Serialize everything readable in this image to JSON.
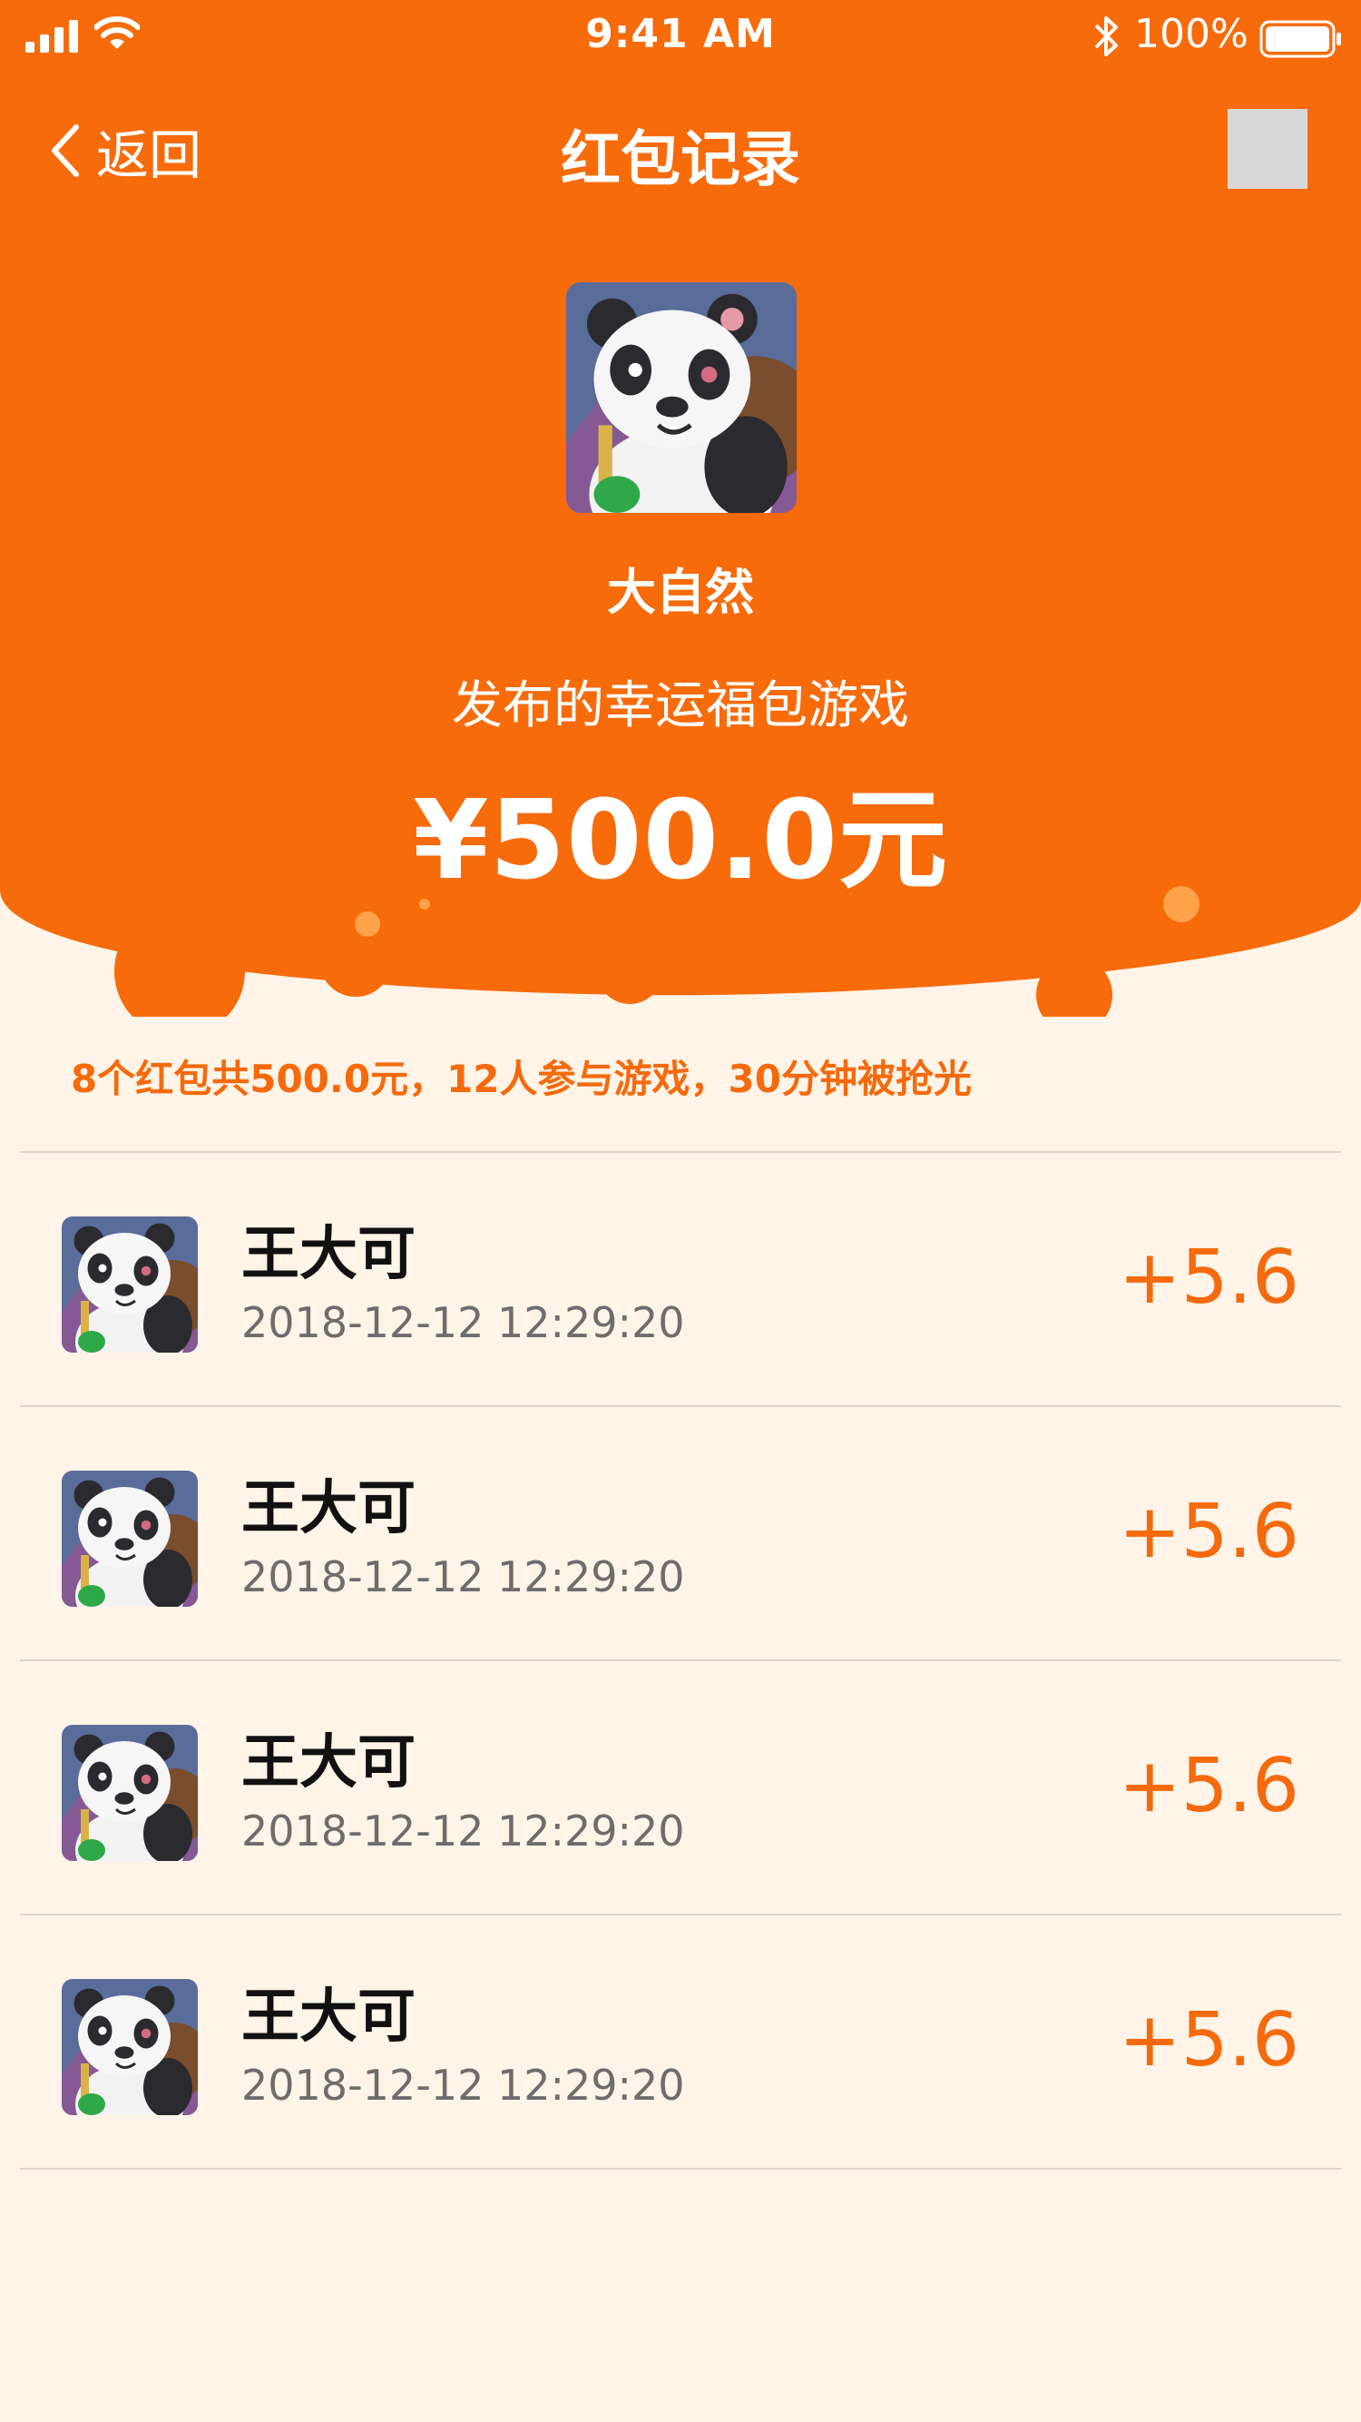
{
  "status_bar": {
    "time": "9:41 AM",
    "battery_percent": "100%",
    "icons": [
      "signal-icon",
      "wifi-icon",
      "bluetooth-icon",
      "battery-icon"
    ]
  },
  "nav": {
    "back_label": "返回",
    "title": "红包记录",
    "back_icon": "chevron-left-icon",
    "menu_icon": "placeholder-square-icon"
  },
  "host": {
    "name": "大自然",
    "description": "发布的幸运福包游戏",
    "amount": "¥500.0元"
  },
  "summary": "8个红包共500.0元，12人参与游戏，30分钟被抢光",
  "records": [
    {
      "name": "王大可",
      "time": "2018-12-12 12:29:20",
      "amount": "+5.6"
    },
    {
      "name": "王大可",
      "time": "2018-12-12 12:29:20",
      "amount": "+5.6"
    },
    {
      "name": "王大可",
      "time": "2018-12-12 12:29:20",
      "amount": "+5.6"
    },
    {
      "name": "王大可",
      "time": "2018-12-12 12:29:20",
      "amount": "+5.6"
    }
  ],
  "colors": {
    "brand_orange": "#f56a0d",
    "page_background": "#fff4e7",
    "amount_text": "#f56a0d",
    "divider": "#dcd4cb"
  }
}
